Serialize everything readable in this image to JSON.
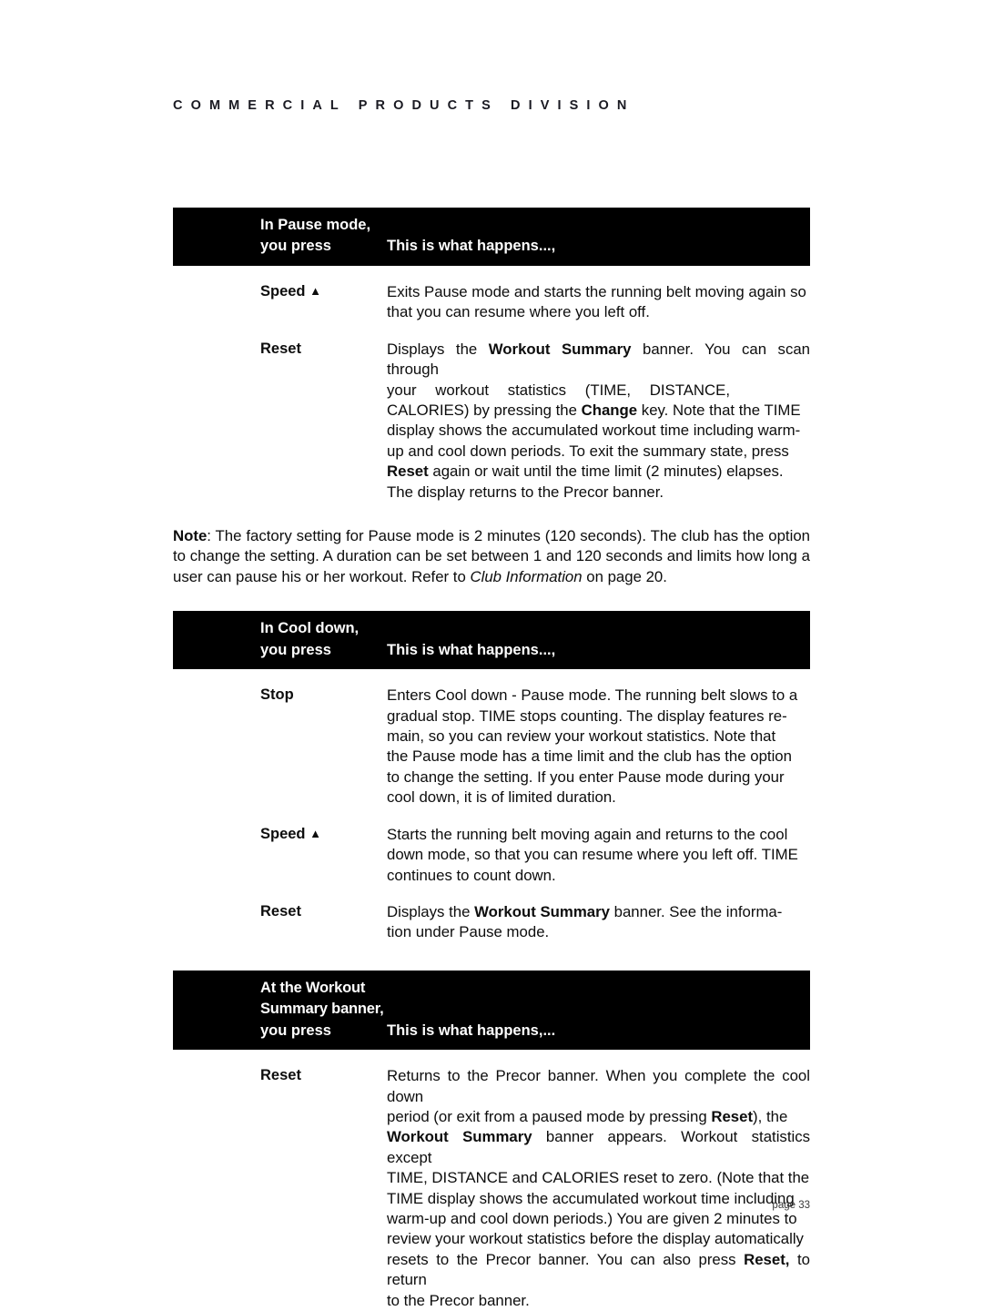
{
  "document": {
    "running_header": "COMMERCIAL PRODUCTS DIVISION",
    "page_label": "page 33"
  },
  "sections": [
    {
      "banner": {
        "title_line1": "In Pause mode,",
        "key_label": "you press",
        "value_label": "This is what happens...,"
      },
      "rows": [
        {
          "term": "Speed",
          "term_icon": "up-triangle",
          "definition": "Exits Pause mode and starts the running belt moving again so that you can resume where you left off."
        },
        {
          "term": "Reset",
          "definition": "Displays the Workout Summary banner. You can scan through your workout statistics (TIME, DISTANCE, CALORIES) by pressing the Change key. Note that the TIME display shows the accumulated workout time including warm-up and cool down periods. To exit the summary state, press Reset again or wait until the time limit (2 minutes) elapses. The display returns to the Precor banner."
        }
      ],
      "note": "Note: The factory setting for Pause mode is 2 minutes (120 seconds). The club has the option to change the setting. A duration can be set between 1 and 120 seconds and limits how long a user can pause his or her workout. Refer to Club Information on page 20."
    },
    {
      "banner": {
        "title_line1": "In Cool down,",
        "key_label": "you press",
        "value_label": "This is what happens...,"
      },
      "rows": [
        {
          "term": "Stop",
          "definition": "Enters Cool down - Pause mode. The running belt slows to a gradual stop. TIME stops counting. The display features remain, so you can review your workout statistics. Note that the Pause mode has a time limit and the club has the option to change the setting. If you enter Pause mode during your cool down, it is of limited duration."
        },
        {
          "term": "Speed",
          "term_icon": "up-triangle",
          "definition": "Starts the running belt moving again and returns to the cool down mode, so that you can resume where you left off. TIME continues to count down."
        },
        {
          "term": "Reset",
          "definition": "Displays the Workout Summary banner. See the information under Pause mode."
        }
      ]
    },
    {
      "banner": {
        "title_line1": "At the Workout",
        "title_line2": "Summary banner,",
        "key_label": "you press",
        "value_label": "This is what happens,..."
      },
      "rows": [
        {
          "term": "Reset",
          "definition": "Returns to the Precor banner. When you complete the cool down period (or exit from a paused mode by pressing Reset), the Workout Summary banner appears. Workout statistics except TIME, DISTANCE and CALORIES reset to zero. (Note that the TIME display shows the accumulated workout time including warm-up and cool down periods.) You are given 2 minutes to review your workout statistics before the display automatically resets to the Precor banner. You can also press Reset, to return to the Precor banner."
        }
      ]
    }
  ],
  "text_fragments": {
    "s1_speed_l1": "Exits Pause mode and starts the running belt moving again so",
    "s1_speed_l2": "that you can resume where you left off.",
    "s1_reset_l1_a": "Displays the ",
    "s1_reset_l1_b": "Workout Summary",
    "s1_reset_l1_c": " banner. You can scan through",
    "s1_reset_l2": "your workout statistics (TIME, DISTANCE,",
    "s1_reset_l3_a": "CALORIES) by pressing the ",
    "s1_reset_l3_b": "Change",
    "s1_reset_l3_c": " key. Note that the TIME",
    "s1_reset_l4": "display shows the accumulated workout time including warm-",
    "s1_reset_l5": "up and cool down periods. To exit the summary state, press",
    "s1_reset_l6_a": "Reset",
    "s1_reset_l6_b": " again or wait until the time limit (2 minutes) elapses.",
    "s1_reset_l7": "The display returns to the Precor banner.",
    "note_a": "Note",
    "note_b": ": The factory setting for Pause mode is 2 minutes (120 seconds). The club has the option to change the setting. A duration can be set between 1 and 120 seconds and limits how long a user can pause his or her workout. Refer to ",
    "note_c": "Club Information",
    "note_d": " on page 20.",
    "s2_stop_l1": "Enters Cool down - Pause mode. The running belt slows to a",
    "s2_stop_l2": "gradual stop. TIME stops counting. The display features re-",
    "s2_stop_l3": "main, so you can review your workout statistics. Note that",
    "s2_stop_l4": "the Pause mode has a time limit and the club has the option",
    "s2_stop_l5": "to change the setting. If you enter Pause mode during your",
    "s2_stop_l6": "cool down, it is of limited duration.",
    "s2_speed_l1": "Starts the running belt moving again and returns to the cool",
    "s2_speed_l2": "down mode, so that you can resume where you left off. TIME",
    "s2_speed_l3": "continues to count down.",
    "s2_reset_l1_a": "Displays the ",
    "s2_reset_l1_b": "Workout Summary",
    "s2_reset_l1_c": " banner. See the informa-",
    "s2_reset_l2": "tion under Pause mode.",
    "s3_reset_l1": "Returns to the Precor banner. When you complete the cool down",
    "s3_reset_l2_a": "period (or exit from a paused mode by pressing ",
    "s3_reset_l2_b": "Reset",
    "s3_reset_l2_c": "), the",
    "s3_reset_l3_a": "Workout Summary",
    "s3_reset_l3_b": " banner appears. Workout statistics except",
    "s3_reset_l4": "TIME, DISTANCE and CALORIES reset to zero. (Note that the",
    "s3_reset_l5": "TIME display shows the accumulated workout time including",
    "s3_reset_l6": "warm-up and cool down periods.) You are given 2 minutes to",
    "s3_reset_l7": "review your workout statistics before the display automatically",
    "s3_reset_l8_a": "resets to the Precor banner. You can also press ",
    "s3_reset_l8_b": "Reset,",
    "s3_reset_l8_c": " to return",
    "s3_reset_l9": "to the Precor banner."
  },
  "glyphs": {
    "up_triangle": "▲"
  }
}
